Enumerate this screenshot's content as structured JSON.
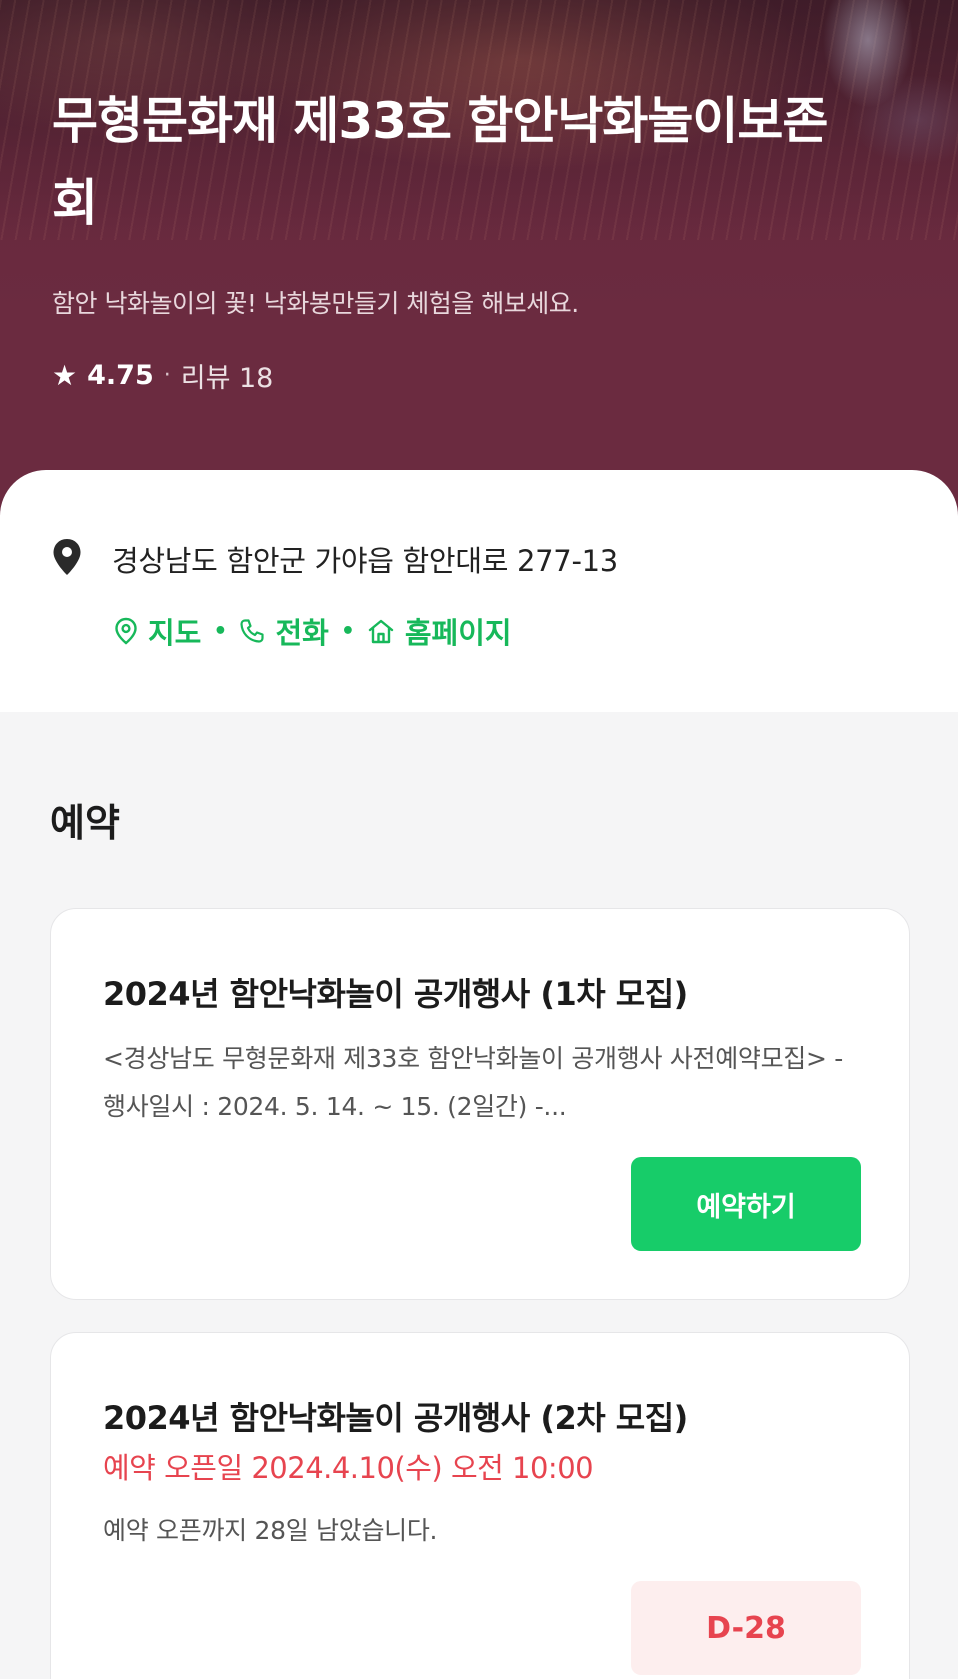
{
  "hero": {
    "title": "무형문화재 제33호 함안낙화놀이보존회",
    "subtitle": "함안 낙화놀이의 꽃! 낙화봉만들기 체험을 해보세요.",
    "rating_star": "★",
    "rating": "4.75",
    "rating_separator": "·",
    "reviews": "리뷰 18"
  },
  "location": {
    "address": "경상남도 함안군 가야읍 함안대로 277-13",
    "links": [
      {
        "label": "지도",
        "icon": "map-pin-outline-icon"
      },
      {
        "label": "전화",
        "icon": "phone-icon"
      },
      {
        "label": "홈페이지",
        "icon": "home-icon"
      }
    ],
    "separator": "•",
    "accent_color": "#17b85a"
  },
  "reservation": {
    "heading": "예약",
    "items": [
      {
        "title": "2024년 함안낙화놀이 공개행사 (1차 모집)",
        "description": "<경상남도 무형문화재 제33호 함안낙화놀이 공개행사 사전예약모집> -행사일시 : 2024. 5. 14. ~ 15. (2일간) -...",
        "button_label": "예약하기",
        "button_color": "#17cc69"
      },
      {
        "title": "2024년 함안낙화놀이 공개행사 (2차 모집)",
        "open_date": "예약 오픈일 2024.4.10(수) 오전 10:00",
        "remaining": "예약 오픈까지 28일 남았습니다.",
        "badge": "D-28",
        "badge_color": "#e7444f"
      }
    ]
  }
}
